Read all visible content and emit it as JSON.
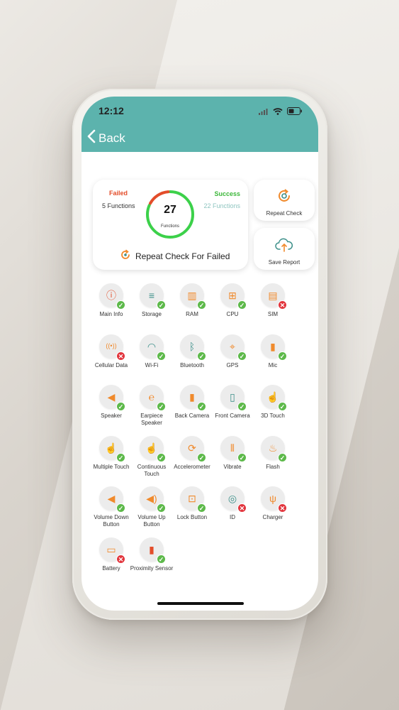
{
  "status": {
    "time": "12:12"
  },
  "nav": {
    "back_label": "Back"
  },
  "summary": {
    "failed_label": "Failed",
    "failed_count": "5 Functions",
    "success_label": "Success",
    "success_count": "22 Functions",
    "total": "27",
    "total_label": "Functions",
    "success_fraction": 0.815,
    "repeat_failed_label": "Repeat Check For Failed"
  },
  "actions": {
    "repeat_check_label": "Repeat Check",
    "save_report_label": "Save Report"
  },
  "colors": {
    "header": "#5cb3ad",
    "failed": "#e34d2a",
    "success": "#3cb73a",
    "pass_badge": "#5db94a",
    "fail_badge": "#e2353d",
    "icon_orange": "#f08a2c",
    "icon_teal": "#3c8f89"
  },
  "functions": [
    {
      "name": "Main Info",
      "status": "pass",
      "icon": "info-icon"
    },
    {
      "name": "Storage",
      "status": "pass",
      "icon": "storage-icon"
    },
    {
      "name": "RAM",
      "status": "pass",
      "icon": "ram-icon"
    },
    {
      "name": "CPU",
      "status": "pass",
      "icon": "cpu-icon"
    },
    {
      "name": "SIM",
      "status": "fail",
      "icon": "sim-icon"
    },
    {
      "name": "Cellular Data",
      "status": "fail",
      "icon": "cellular-data-icon"
    },
    {
      "name": "Wi-Fi",
      "status": "pass",
      "icon": "wifi-icon"
    },
    {
      "name": "Bluetooth",
      "status": "pass",
      "icon": "bluetooth-icon"
    },
    {
      "name": "GPS",
      "status": "pass",
      "icon": "gps-icon"
    },
    {
      "name": "Mic",
      "status": "pass",
      "icon": "mic-icon"
    },
    {
      "name": "Speaker",
      "status": "pass",
      "icon": "speaker-icon"
    },
    {
      "name": "Earpiece Speaker",
      "status": "pass",
      "icon": "ear-icon"
    },
    {
      "name": "Back Camera",
      "status": "pass",
      "icon": "back-camera-icon"
    },
    {
      "name": "Front Camera",
      "status": "pass",
      "icon": "front-camera-icon"
    },
    {
      "name": "3D Touch",
      "status": "pass",
      "icon": "3d-touch-icon"
    },
    {
      "name": "Multiple Touch",
      "status": "pass",
      "icon": "multi-touch-icon"
    },
    {
      "name": "Continuous Touch",
      "status": "pass",
      "icon": "continuous-touch-icon"
    },
    {
      "name": "Accelerometer",
      "status": "pass",
      "icon": "accelerometer-icon"
    },
    {
      "name": "Vibrate",
      "status": "pass",
      "icon": "vibrate-icon"
    },
    {
      "name": "Flash",
      "status": "pass",
      "icon": "flash-icon"
    },
    {
      "name": "Volume Down Button",
      "status": "pass",
      "icon": "volume-down-icon"
    },
    {
      "name": "Volume Up Button",
      "status": "pass",
      "icon": "volume-up-icon"
    },
    {
      "name": "Lock Button",
      "status": "pass",
      "icon": "lock-icon"
    },
    {
      "name": "ID",
      "status": "fail",
      "icon": "fingerprint-icon"
    },
    {
      "name": "Charger",
      "status": "fail",
      "icon": "charger-icon"
    },
    {
      "name": "Battery",
      "status": "fail",
      "icon": "battery-icon"
    },
    {
      "name": "Proximity Sensor",
      "status": "pass",
      "icon": "proximity-icon"
    }
  ]
}
